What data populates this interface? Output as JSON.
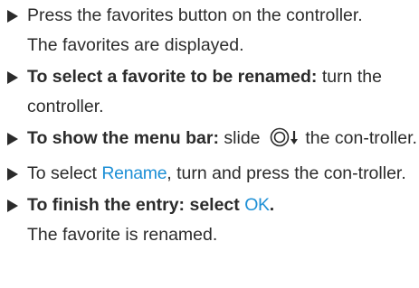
{
  "steps": [
    {
      "text": "Press the favorites button on the controller.",
      "result": "The favorites are displayed."
    },
    {
      "bold": "To select a favorite to be renamed:",
      "text": " turn the controller."
    },
    {
      "bold": "To show the menu bar:",
      "text_before": " slide ",
      "icon": "controller-slide-down-icon",
      "text_after": " the con-troller."
    },
    {
      "text_before": "To select ",
      "highlight": "Rename",
      "text_after": ", turn and press the con-troller."
    },
    {
      "bold_before": "To finish the entry: select ",
      "highlight": "OK",
      "bold_after": ".",
      "result": "The favorite is renamed."
    }
  ],
  "colors": {
    "text": "#2b2b2b",
    "highlight": "#1e90d6"
  }
}
